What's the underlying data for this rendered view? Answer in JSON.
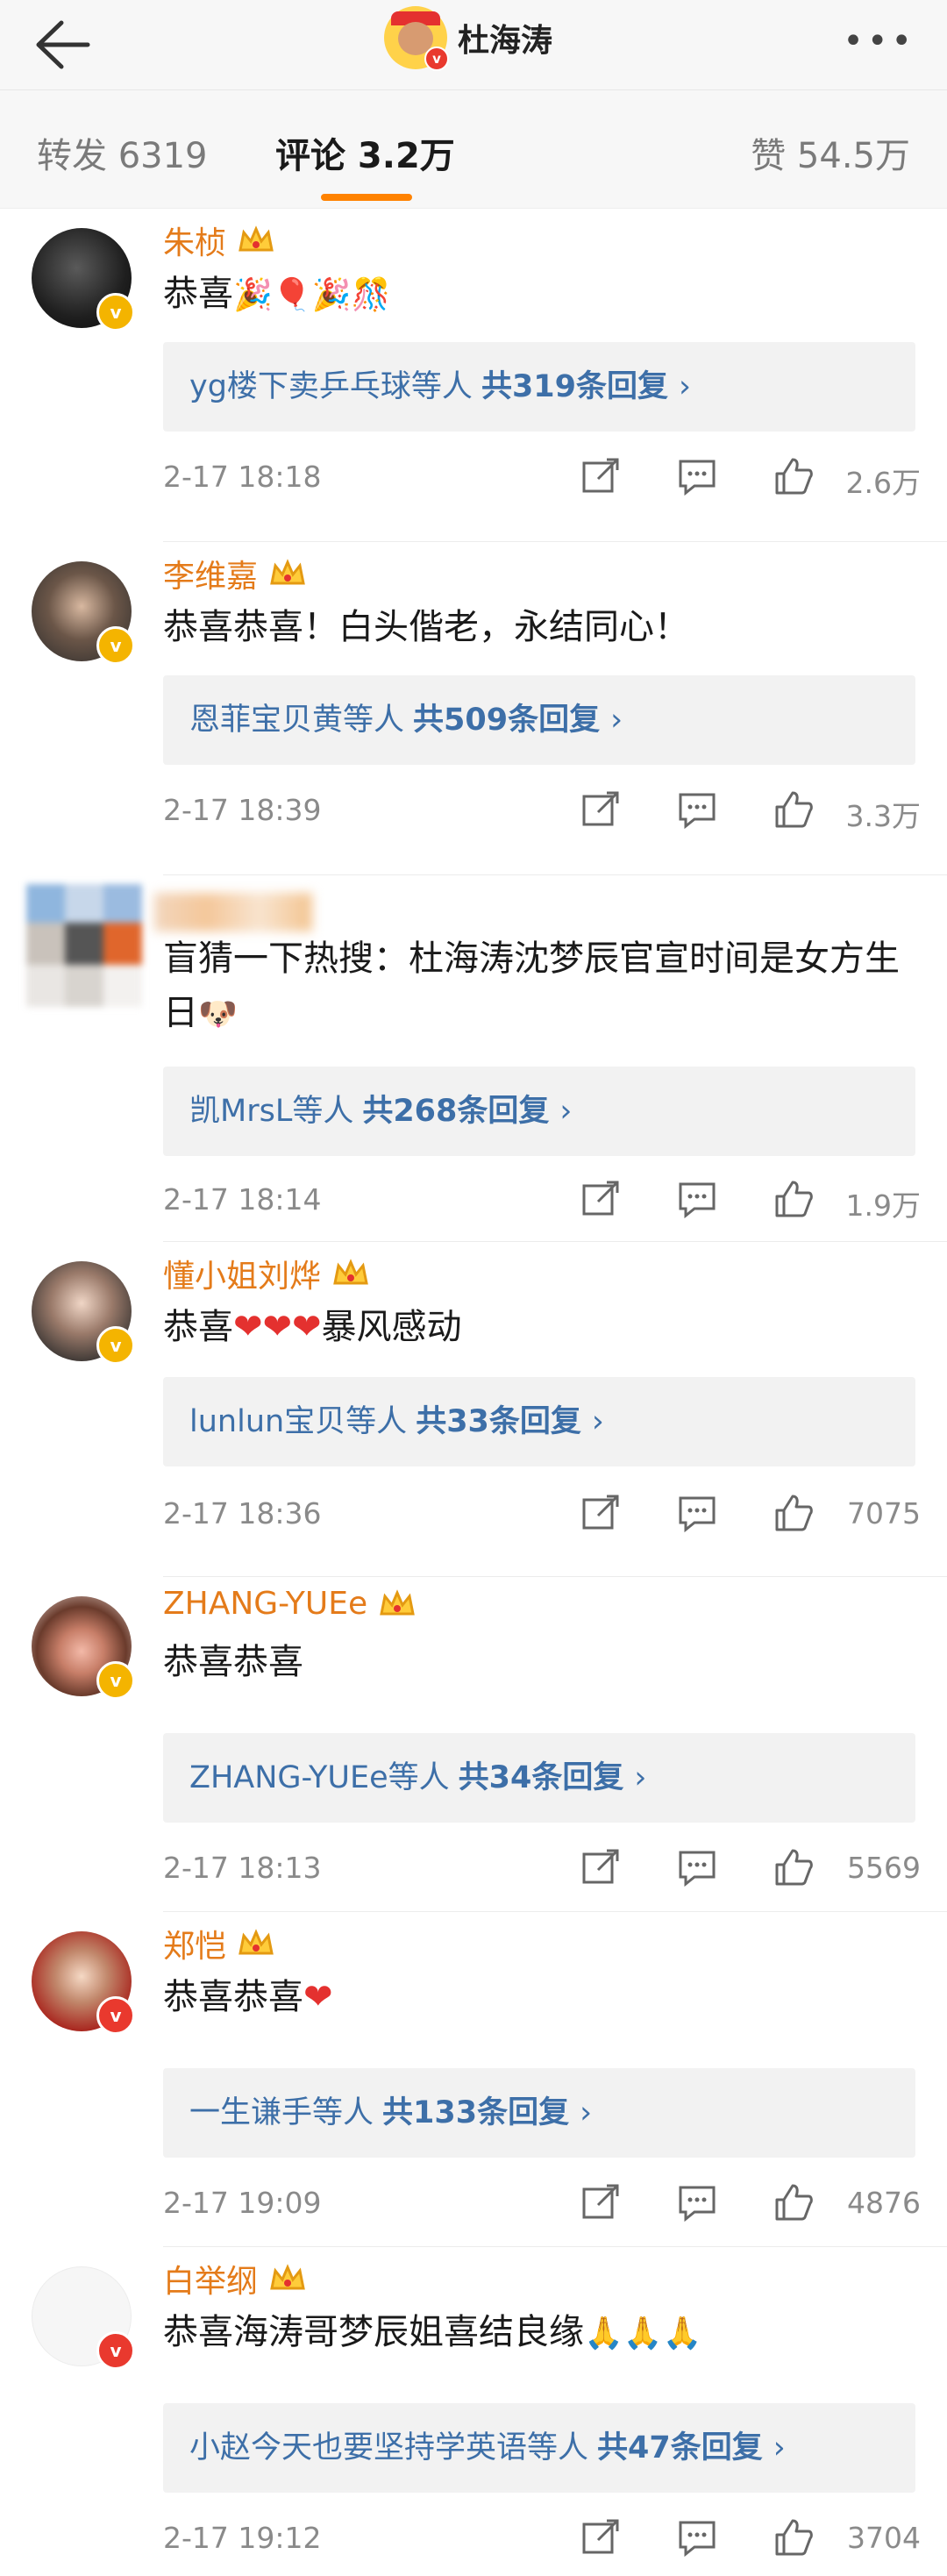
{
  "header": {
    "back_icon": "back-arrow-icon",
    "title": "杜海涛",
    "more_icon": "more-dots-icon"
  },
  "tabs": [
    {
      "label": "转发 6319"
    },
    {
      "label": "评论 3.2万"
    },
    {
      "label": "赞 54.5万"
    }
  ],
  "accent": "#ff8200",
  "comments": [
    {
      "name": "朱桢",
      "text": "恭喜",
      "emoji": "🎉🎈🎉🎊",
      "reply_users": "yg楼下卖乒乓球等人",
      "reply_count": "共319条回复",
      "time": "2-17 18:18",
      "likes": "2.6万"
    },
    {
      "name": "李维嘉",
      "text": "恭喜恭喜！白头偕老，永结同心！",
      "emoji": "",
      "reply_users": "恩菲宝贝黄等人",
      "reply_count": "共509条回复",
      "time": "2-17 18:39",
      "likes": "3.3万"
    },
    {
      "name": "",
      "text": "盲猜一下热搜：杜海涛沈梦辰官宣时间是女方生日",
      "emoji": "🐶",
      "reply_users": "凯MrsL等人",
      "reply_count": "共268条回复",
      "time": "2-17 18:14",
      "likes": "1.9万"
    },
    {
      "name": "懂小姐刘烨",
      "text": "恭喜",
      "emoji": "❤❤❤",
      "text_after": "暴风感动",
      "reply_users": "lunlun宝贝等人",
      "reply_count": "共33条回复",
      "time": "2-17 18:36",
      "likes": "7075"
    },
    {
      "name": "ZHANG-YUEe",
      "text": "恭喜恭喜",
      "emoji": "",
      "reply_users": "ZHANG-YUEe等人",
      "reply_count": "共34条回复",
      "time": "2-17 18:13",
      "likes": "5569"
    },
    {
      "name": "郑恺",
      "text": "恭喜恭喜",
      "emoji": "❤",
      "reply_users": "一生谦手等人",
      "reply_count": "共133条回复",
      "time": "2-17 19:09",
      "likes": "4876"
    },
    {
      "name": "白举纲",
      "text": "恭喜海涛哥梦辰姐喜结良缘",
      "emoji": "🙏🙏🙏",
      "reply_users": "小赵今天也要坚持学英语等人",
      "reply_count": "共47条回复",
      "time": "2-17 19:12",
      "likes": "3704"
    }
  ],
  "chevron": "›"
}
